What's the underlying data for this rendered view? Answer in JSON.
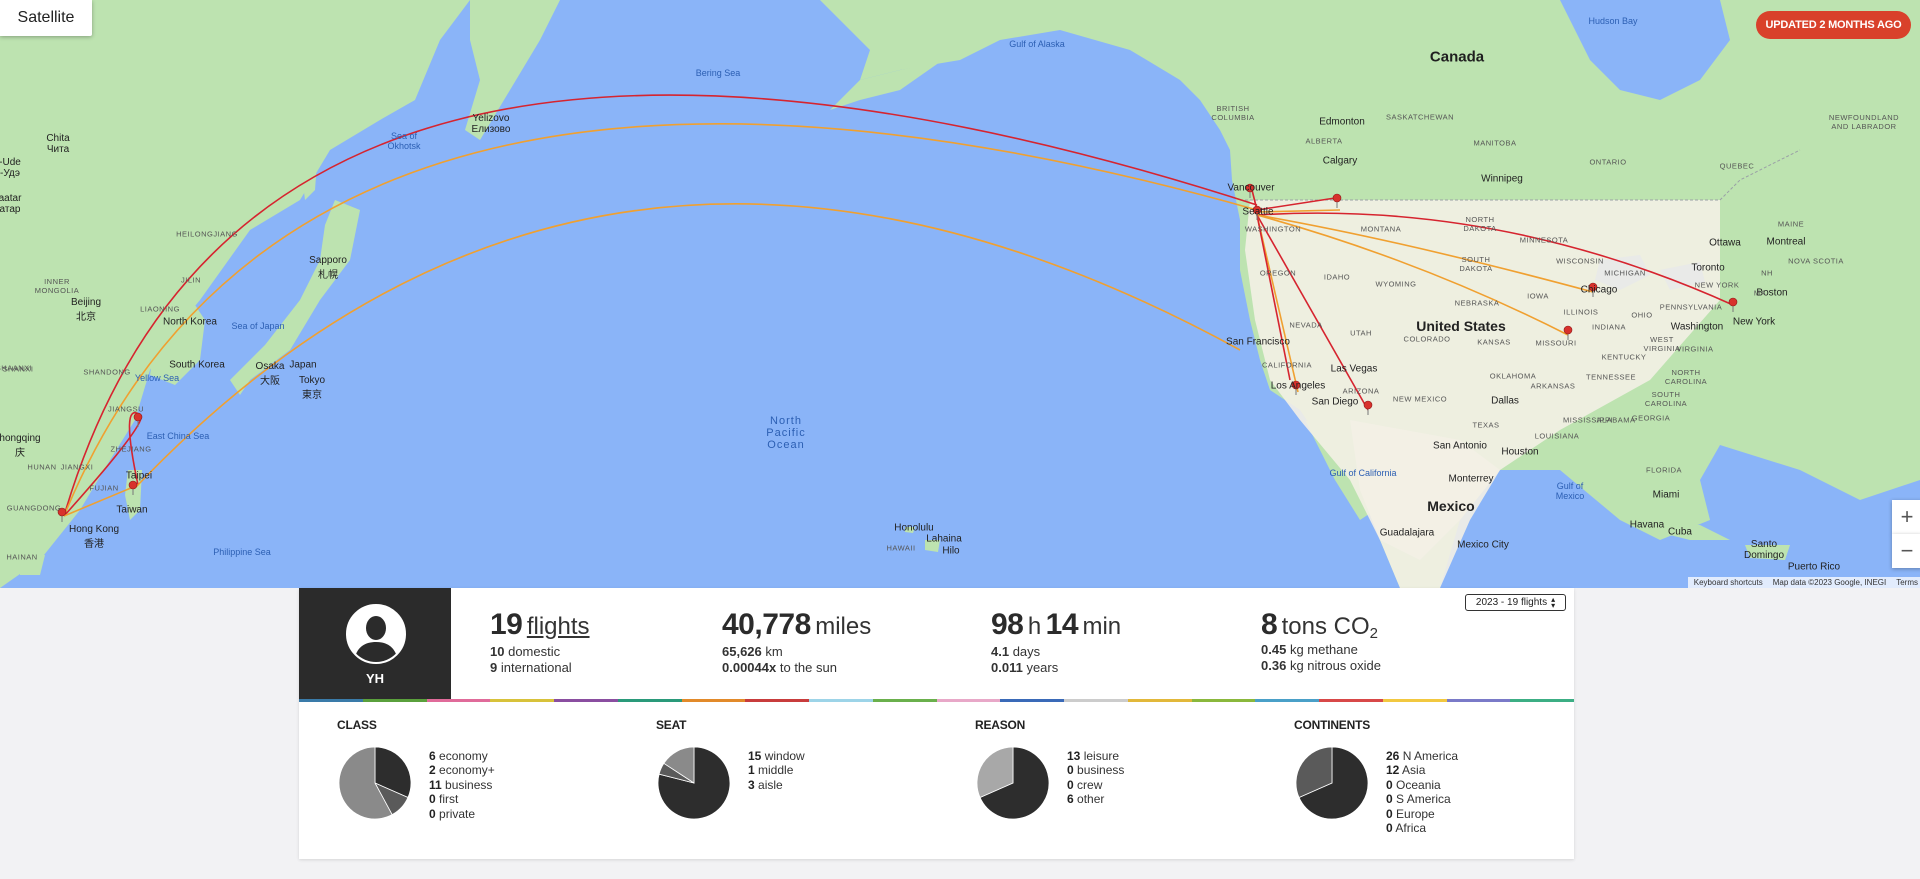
{
  "map": {
    "satellite_label": "Satellite",
    "updated_label": "UPDATED 2 MONTHS AGO",
    "zoom_in": "+",
    "zoom_out": "−",
    "attribution": [
      "Keyboard shortcuts",
      "Map data ©2023 Google, INEGI",
      "Terms"
    ],
    "labels": {
      "canada": "Canada",
      "united_states": "United States",
      "mexico": "Mexico",
      "north_korea": "North Korea",
      "south_korea": "South Korea",
      "japan": "Japan",
      "taiwan": "Taiwan",
      "cuba": "Cuba",
      "hudson_bay": "Hudson Bay",
      "gulf_alaska": "Gulf of Alaska",
      "bering_sea": "Bering Sea",
      "sea_okhotsk": "Sea of\nOkhotsk",
      "sea_japan": "Sea of Japan",
      "yellow_sea": "Yellow Sea",
      "east_china_sea": "East China Sea",
      "philippine_sea": "Philippine Sea",
      "gulf_california": "Gulf of California",
      "gulf_mexico": "Gulf of\nMexico",
      "north_pacific": "North\nPacific\nOcean",
      "vancouver": "Vancouver",
      "seattle": "Seattle",
      "edmonton": "Edmonton",
      "calgary": "Calgary",
      "winnipeg": "Winnipeg",
      "ottawa": "Ottawa",
      "montreal": "Montreal",
      "toronto": "Toronto",
      "boston": "Boston",
      "new_york": "New York",
      "washington": "Washington",
      "chicago": "Chicago",
      "dallas": "Dallas",
      "houston": "Houston",
      "san_antonio": "San Antonio",
      "san_francisco": "San Francisco",
      "los_angeles": "Los Angeles",
      "san_diego": "San Diego",
      "las_vegas": "Las Vegas",
      "miami": "Miami",
      "havana": "Havana",
      "monterrey": "Monterrey",
      "guadalajara": "Guadalajara",
      "mexico_city": "Mexico City",
      "santo_domingo": "Santo\nDomingo",
      "puerto_rico": "Puerto Rico",
      "honolulu": "Honolulu",
      "lahaina": "Lahaina",
      "hilo": "Hilo",
      "hawaii": "HAWAII",
      "beijing": "Beijing\n北京",
      "osaka": "Osaka\n大阪",
      "tokyo": "Tokyo\n東京",
      "sapporo": "Sapporo\n札幌",
      "hong_kong": "Hong Kong\n香港",
      "taipei": "Taipei",
      "yelizovo": "Yelizovo\nЕлизово",
      "chita": "Chita\nЧита",
      "chongqing": "hongqing\n庆",
      "inner_mongolia": "INNER\nMONGOLIA",
      "heilongjiang": "HEILONGJIANG",
      "jilin": "JILIN",
      "liaoning": "LIAONING",
      "shandong": "SHANDONG",
      "jiangsu": "JIANGSU",
      "hunan": "HUNAN",
      "jiangxi": "JIANGXI",
      "guangdong": "GUANGDONG",
      "zhejiang": "ZHEJIANG",
      "hainan": "HAINAN",
      "shanxi": "SHANXI",
      "fujian": "FUJIAN",
      "british_columbia": "BRITISH\nCOLUMBIA",
      "alberta": "ALBERTA",
      "saskatchewan": "SASKATCHEWAN",
      "manitoba": "MANITOBA",
      "ontario": "ONTARIO",
      "quebec": "QUEBEC",
      "newfoundland": "NEWFOUNDLAND\nAND LABRADOR",
      "nova_scotia": "NOVA SCOTIA",
      "washington_state": "WASHINGTON",
      "oregon": "OREGON",
      "idaho": "IDAHO",
      "montana": "MONTANA",
      "wyoming": "WYOMING",
      "nevada": "NEVADA",
      "utah": "UTAH",
      "colorado": "COLORADO",
      "california": "CALIFORNIA",
      "arizona": "ARIZONA",
      "new_mexico": "NEW MEXICO",
      "texas": "TEXAS",
      "north_dakota": "NORTH\nDAKOTA",
      "south_dakota": "SOUTH\nDAKOTA",
      "nebraska": "NEBRASKA",
      "kansas": "KANSAS",
      "oklahoma": "OKLAHOMA",
      "minnesota": "MINNESOTA",
      "iowa": "IOWA",
      "missouri": "MISSOURI",
      "wisconsin": "WISCONSIN",
      "michigan": "MICHIGAN",
      "illinois": "ILLINOIS",
      "indiana": "INDIANA",
      "ohio": "OHIO",
      "kentucky": "KENTUCKY",
      "tennessee": "TENNESSEE",
      "arkansas": "ARKANSAS",
      "louisiana": "LOUISIANA",
      "mississippi": "MISSISSIPPI",
      "alabama": "ALABAMA",
      "georgia": "GEORGIA",
      "florida": "FLORIDA",
      "south_carolina": "SOUTH\nCAROLINA",
      "north_carolina": "NORTH\nCAROLINA",
      "virginia": "VIRGINIA",
      "west_virginia": "WEST\nVIRGINIA",
      "pennsylvania": "PENNSYLVANIA",
      "new_york_state": "NEW YORK",
      "maine": "MAINE",
      "nh": "NH",
      "ma": "MA",
      "ulaanbaatar": "aatar\nатар",
      "ude": "-Ude\n-Удэ",
      "shaanxi": "SHAANXI"
    },
    "colors": {
      "water": "#8ab4f8",
      "land": "#bde3b0",
      "route_red": "#d6242f",
      "route_orange": "#f0a030",
      "pin": "#d8312c"
    }
  },
  "profile": {
    "initials": "YH"
  },
  "year_select": {
    "value": "2023 - 19 flights"
  },
  "stats": {
    "flights": {
      "value": "19",
      "unit": "flights",
      "domestic_value": "10",
      "domestic_label": "domestic",
      "intl_value": "9",
      "intl_label": "international"
    },
    "distance": {
      "value": "40,778",
      "unit": "miles",
      "km_value": "65,626",
      "km_label": "km",
      "sun_value": "0.00044x",
      "sun_label": "to the sun"
    },
    "time": {
      "hours": "98",
      "h": "h",
      "minutes": "14",
      "min": "min",
      "days_value": "4.1",
      "days_label": "days",
      "years_value": "0.011",
      "years_label": "years"
    },
    "co2": {
      "value": "8",
      "unit": "tons CO",
      "sub": "2",
      "methane_value": "0.45",
      "methane_label": "kg methane",
      "nitrous_value": "0.36",
      "nitrous_label": "kg nitrous oxide"
    }
  },
  "stripe_colors": [
    "#3a7ba9",
    "#5aa03c",
    "#e06b9a",
    "#d8c23a",
    "#8a4ea0",
    "#2a9a7a",
    "#e28a2a",
    "#c83c3c",
    "#9dd4e8",
    "#6ab04c",
    "#e8a8c8",
    "#3a6ab8",
    "#cccccc",
    "#e2b83a",
    "#8ab83c",
    "#4aa0c8",
    "#d84848",
    "#f2c840",
    "#7a7ac8",
    "#3cae84"
  ],
  "breakdowns": [
    {
      "title": "CLASS",
      "items": [
        {
          "value": "6",
          "label": "economy"
        },
        {
          "value": "2",
          "label": "economy+"
        },
        {
          "value": "11",
          "label": "business"
        },
        {
          "value": "0",
          "label": "first"
        },
        {
          "value": "0",
          "label": "private"
        }
      ],
      "slices": [
        6,
        2,
        11,
        0,
        0
      ],
      "colors": [
        "#2d2d2d",
        "#5a5a5a",
        "#8a8a8a",
        "#aaaaaa",
        "#c8c8c8"
      ]
    },
    {
      "title": "SEAT",
      "items": [
        {
          "value": "15",
          "label": "window"
        },
        {
          "value": "1",
          "label": "middle"
        },
        {
          "value": "3",
          "label": "aisle"
        }
      ],
      "slices": [
        15,
        1,
        3
      ],
      "colors": [
        "#2d2d2d",
        "#5a5a5a",
        "#8a8a8a"
      ]
    },
    {
      "title": "REASON",
      "items": [
        {
          "value": "13",
          "label": "leisure"
        },
        {
          "value": "0",
          "label": "business"
        },
        {
          "value": "0",
          "label": "crew"
        },
        {
          "value": "6",
          "label": "other"
        }
      ],
      "slices": [
        13,
        0,
        0,
        6
      ],
      "colors": [
        "#2d2d2d",
        "#5a5a5a",
        "#8a8a8a",
        "#a8a8a8"
      ]
    },
    {
      "title": "CONTINENTS",
      "items": [
        {
          "value": "26",
          "label": "N America"
        },
        {
          "value": "12",
          "label": "Asia"
        },
        {
          "value": "0",
          "label": "Oceania"
        },
        {
          "value": "0",
          "label": "S America"
        },
        {
          "value": "0",
          "label": "Europe"
        },
        {
          "value": "0",
          "label": "Africa"
        }
      ],
      "slices": [
        26,
        12,
        0,
        0,
        0,
        0
      ],
      "colors": [
        "#2d2d2d",
        "#5a5a5a",
        "#8a8a8a",
        "#9a9a9a",
        "#aaaaaa",
        "#bababa"
      ]
    }
  ]
}
